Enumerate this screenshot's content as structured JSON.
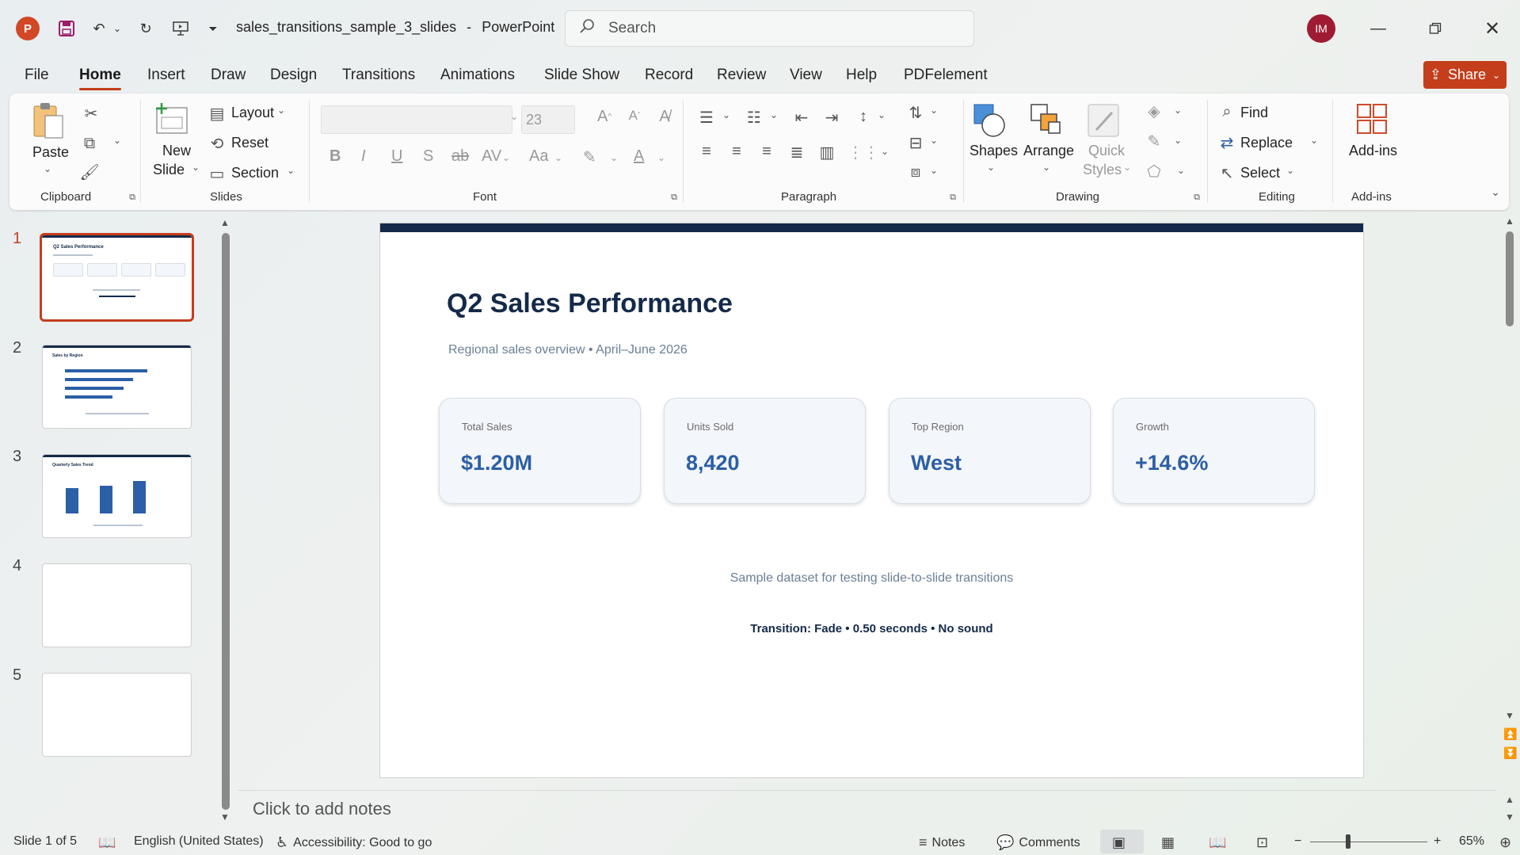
{
  "app": {
    "logo_letter": "P",
    "doc_name": "sales_transitions_sample_3_slides",
    "app_name": "PowerPoint",
    "title_separator": "-",
    "search_placeholder": "Search",
    "user_initials": "IM",
    "accent_color": "#c43e1c"
  },
  "menu": {
    "tabs": [
      "File",
      "Home",
      "Insert",
      "Draw",
      "Design",
      "Transitions",
      "Animations",
      "Slide Show",
      "Record",
      "Review",
      "View",
      "Help",
      "PDFelement"
    ],
    "active_tab": "Home",
    "share_label": "Share"
  },
  "ribbon": {
    "groups": {
      "clipboard": "Clipboard",
      "slides": "Slides",
      "font": "Font",
      "paragraph": "Paragraph",
      "drawing": "Drawing",
      "editing": "Editing",
      "addins": "Add-ins"
    },
    "paste": "Paste",
    "new_slide": "New",
    "new_slide_2": "Slide",
    "layout": "Layout",
    "reset": "Reset",
    "section": "Section",
    "font_size": "23",
    "shapes": "Shapes",
    "arrange": "Arrange",
    "quick_styles_1": "Quick",
    "quick_styles_2": "Styles",
    "find": "Find",
    "replace": "Replace",
    "select": "Select",
    "add_ins": "Add-ins"
  },
  "thumbnails": {
    "numbers": [
      "1",
      "2",
      "3",
      "4",
      "5"
    ],
    "active": 1,
    "slide1_title": "Q2 Sales Performance",
    "slide2_title": "Sales by Region",
    "slide3_title": "Quarterly Sales Trend"
  },
  "slide": {
    "title": "Q2 Sales Performance",
    "subtitle": "Regional sales overview • April–June 2026",
    "kpis": [
      {
        "label": "Total Sales",
        "value": "$1.20M"
      },
      {
        "label": "Units Sold",
        "value": "8,420"
      },
      {
        "label": "Top Region",
        "value": "West"
      },
      {
        "label": "Growth",
        "value": "+14.6%"
      }
    ],
    "footnote": "Sample dataset for testing slide-to-slide transitions",
    "transition_note": "Transition: Fade • 0.50 seconds • No sound",
    "colors": {
      "navy": "#142a4a",
      "value_blue": "#2b5fa6",
      "muted": "#6a7f96"
    }
  },
  "notes": {
    "placeholder": "Click to add notes"
  },
  "status": {
    "slide_info": "Slide 1 of 5",
    "language": "English (United States)",
    "accessibility": "Accessibility: Good to go",
    "notes": "Notes",
    "comments": "Comments",
    "zoom": "65%"
  }
}
